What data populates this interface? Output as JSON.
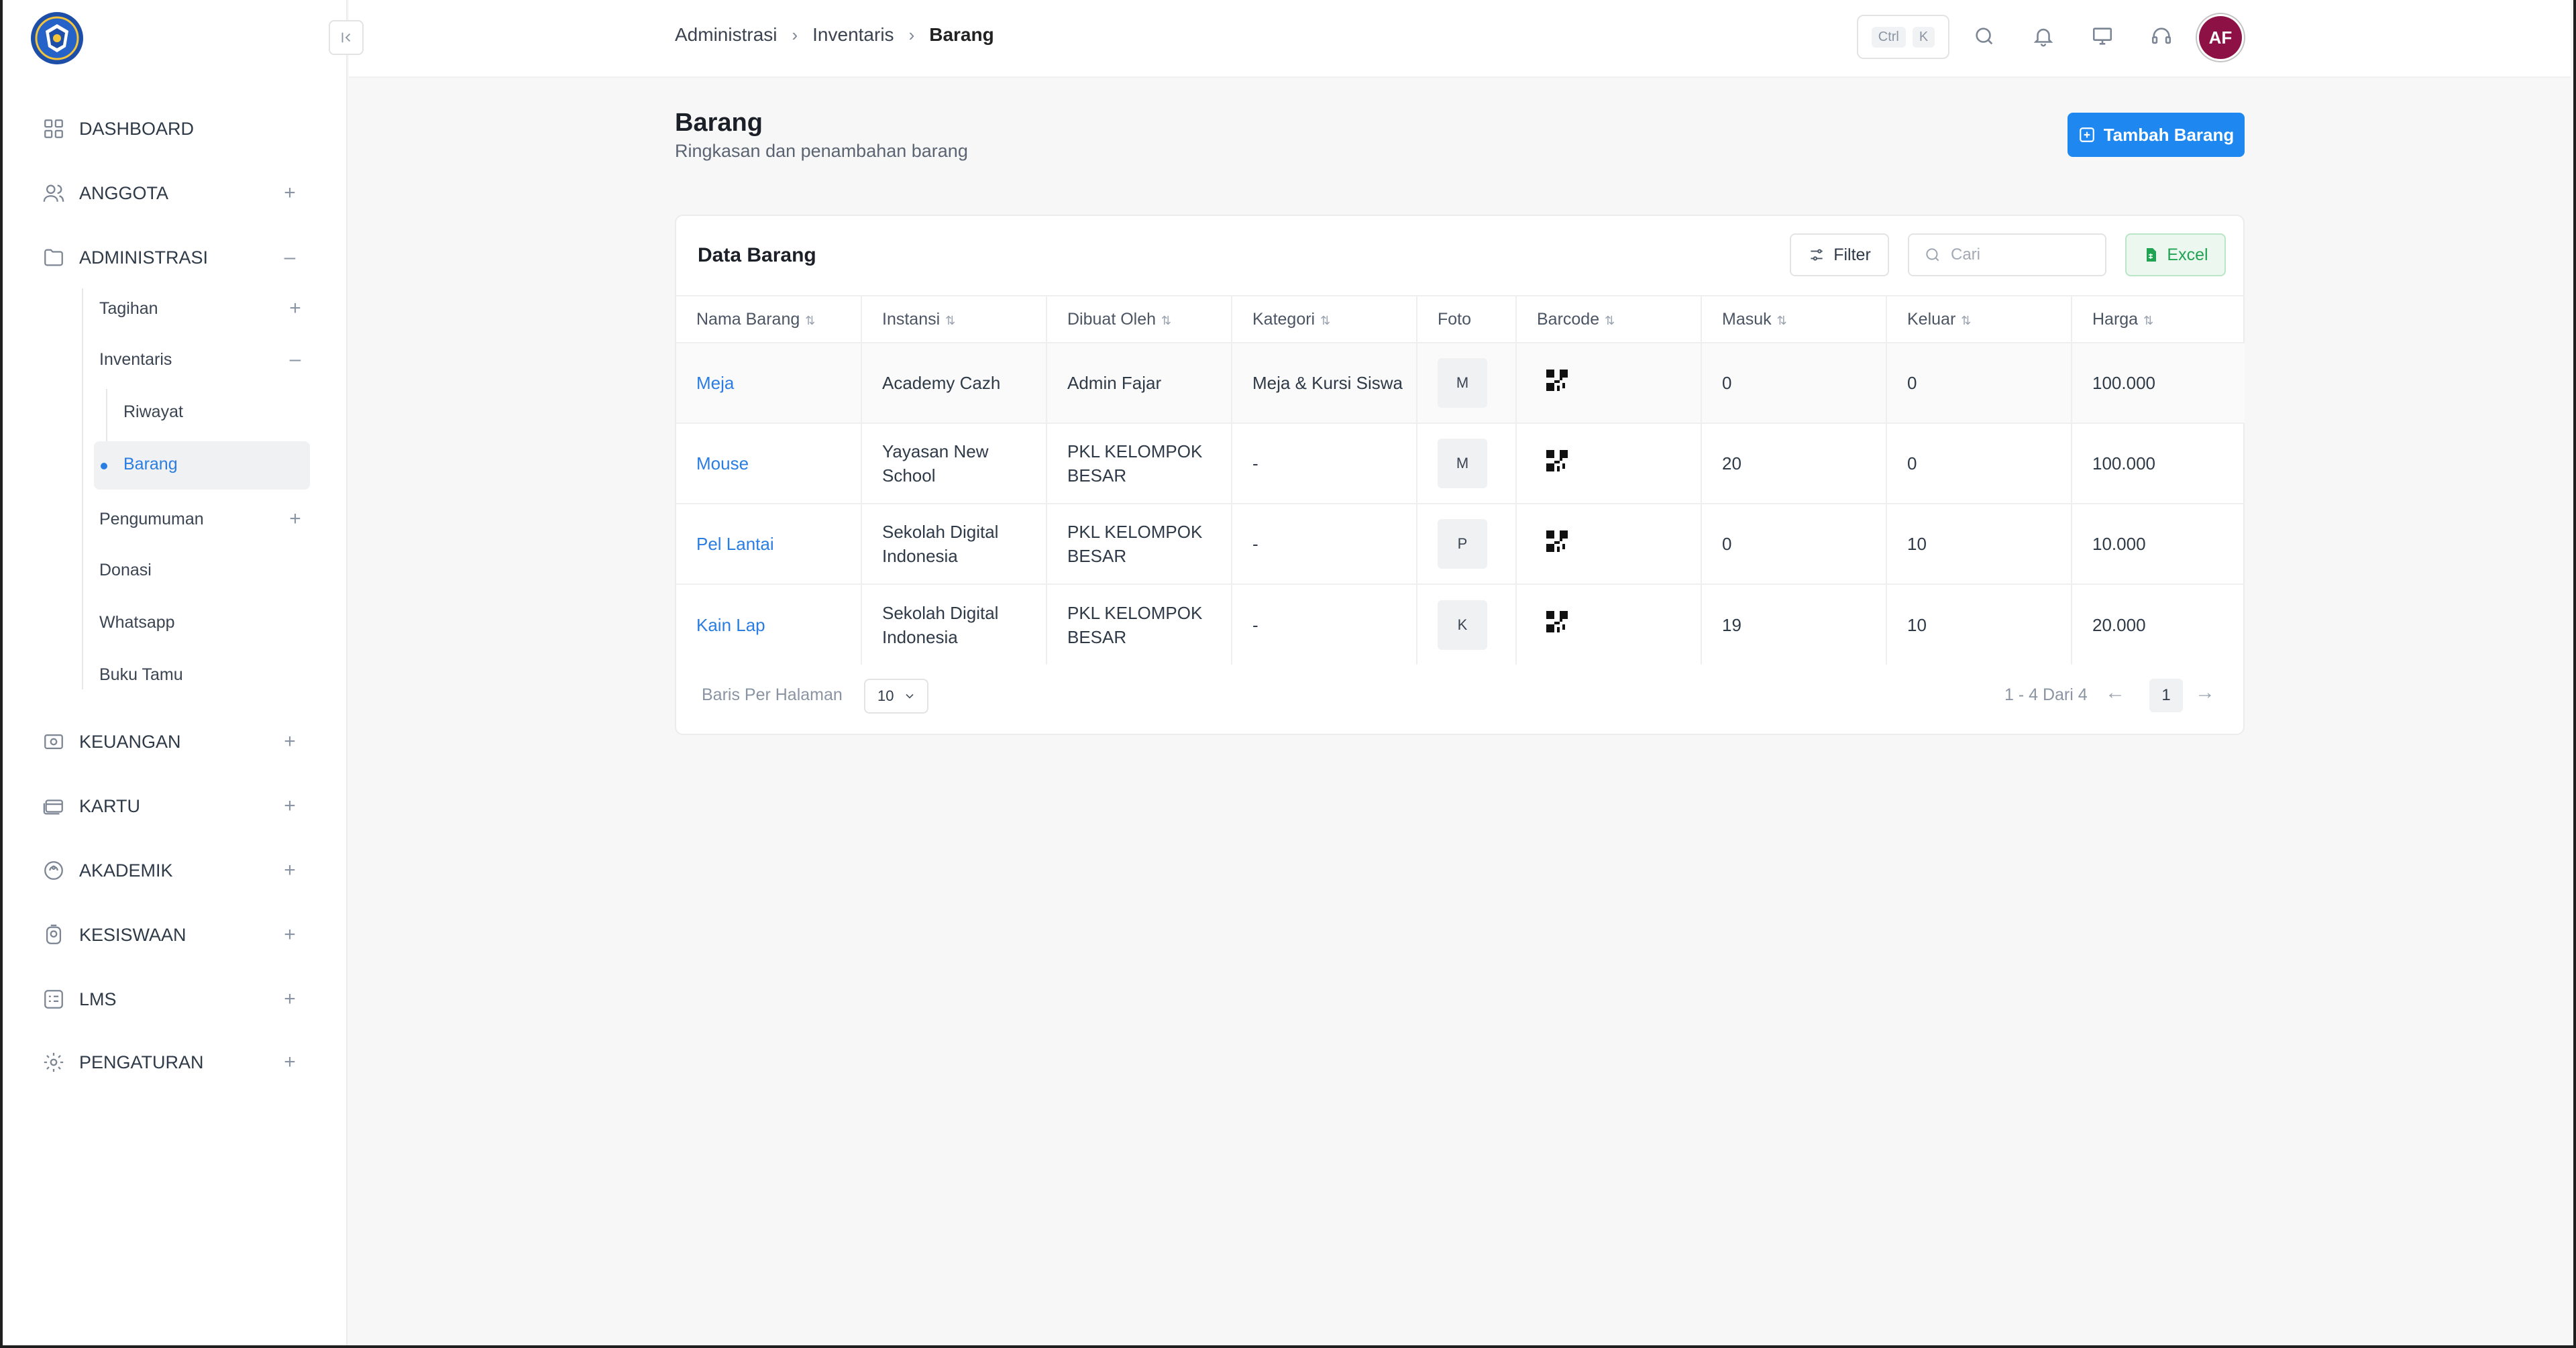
{
  "breadcrumb": [
    "Administrasi",
    "Inventaris",
    "Barang"
  ],
  "topbar": {
    "kbd_ctrl": "Ctrl",
    "kbd_k": "K",
    "avatar_initials": "AF",
    "avatar_color": "#8e1145"
  },
  "sidebar": {
    "items": [
      {
        "label": "DASHBOARD",
        "icon": "grid-icon",
        "toggle": ""
      },
      {
        "label": "ANGGOTA",
        "icon": "users-icon",
        "toggle": "+"
      },
      {
        "label": "ADMINISTRASI",
        "icon": "folder-icon",
        "toggle": "–"
      },
      {
        "label": "KEUANGAN",
        "icon": "cash-icon",
        "toggle": "+"
      },
      {
        "label": "KARTU",
        "icon": "card-icon",
        "toggle": "+"
      },
      {
        "label": "AKADEMIK",
        "icon": "academic-icon",
        "toggle": "+"
      },
      {
        "label": "KESISWAAN",
        "icon": "student-icon",
        "toggle": "+"
      },
      {
        "label": "LMS",
        "icon": "lms-icon",
        "toggle": "+"
      },
      {
        "label": "PENGATURAN",
        "icon": "gear-icon",
        "toggle": "+"
      }
    ],
    "sub": {
      "tagihan": "Tagihan",
      "inventaris": "Inventaris",
      "riwayat": "Riwayat",
      "barang": "Barang",
      "pengumuman": "Pengumuman",
      "donasi": "Donasi",
      "whatsapp": "Whatsapp",
      "buku_tamu": "Buku Tamu"
    }
  },
  "page": {
    "title": "Barang",
    "subtitle": "Ringkasan dan penambahan barang",
    "add_button": "Tambah Barang"
  },
  "card": {
    "title": "Data Barang",
    "filter_label": "Filter",
    "search_placeholder": "Cari",
    "excel_label": "Excel"
  },
  "table": {
    "headers": [
      "Nama Barang",
      "Instansi",
      "Dibuat Oleh",
      "Kategori",
      "Foto",
      "Barcode",
      "Masuk",
      "Keluar",
      "Harga"
    ],
    "rows": [
      {
        "nama": "Meja",
        "instansi": "Academy Cazh",
        "dibuat": "Admin Fajar",
        "kategori": "Meja & Kursi Siswa",
        "foto": "M",
        "masuk": "0",
        "keluar": "0",
        "harga": "100.000"
      },
      {
        "nama": "Mouse",
        "instansi": "Yayasan New School",
        "dibuat": "PKL KELOMPOK BESAR",
        "kategori": "-",
        "foto": "M",
        "masuk": "20",
        "keluar": "0",
        "harga": "100.000"
      },
      {
        "nama": "Pel Lantai",
        "instansi": "Sekolah Digital Indonesia",
        "dibuat": "PKL KELOMPOK BESAR",
        "kategori": "-",
        "foto": "P",
        "masuk": "0",
        "keluar": "10",
        "harga": "10.000"
      },
      {
        "nama": "Kain Lap",
        "instansi": "Sekolah Digital Indonesia",
        "dibuat": "PKL KELOMPOK BESAR",
        "kategori": "-",
        "foto": "K",
        "masuk": "19",
        "keluar": "10",
        "harga": "20.000"
      }
    ]
  },
  "footer": {
    "rows_label": "Baris Per Halaman",
    "rows_value": "10",
    "range": "1 - 4 Dari 4",
    "page": "1"
  },
  "colors": {
    "accent": "#1e88f0",
    "link": "#2a7de1",
    "excel": "#20a352"
  }
}
